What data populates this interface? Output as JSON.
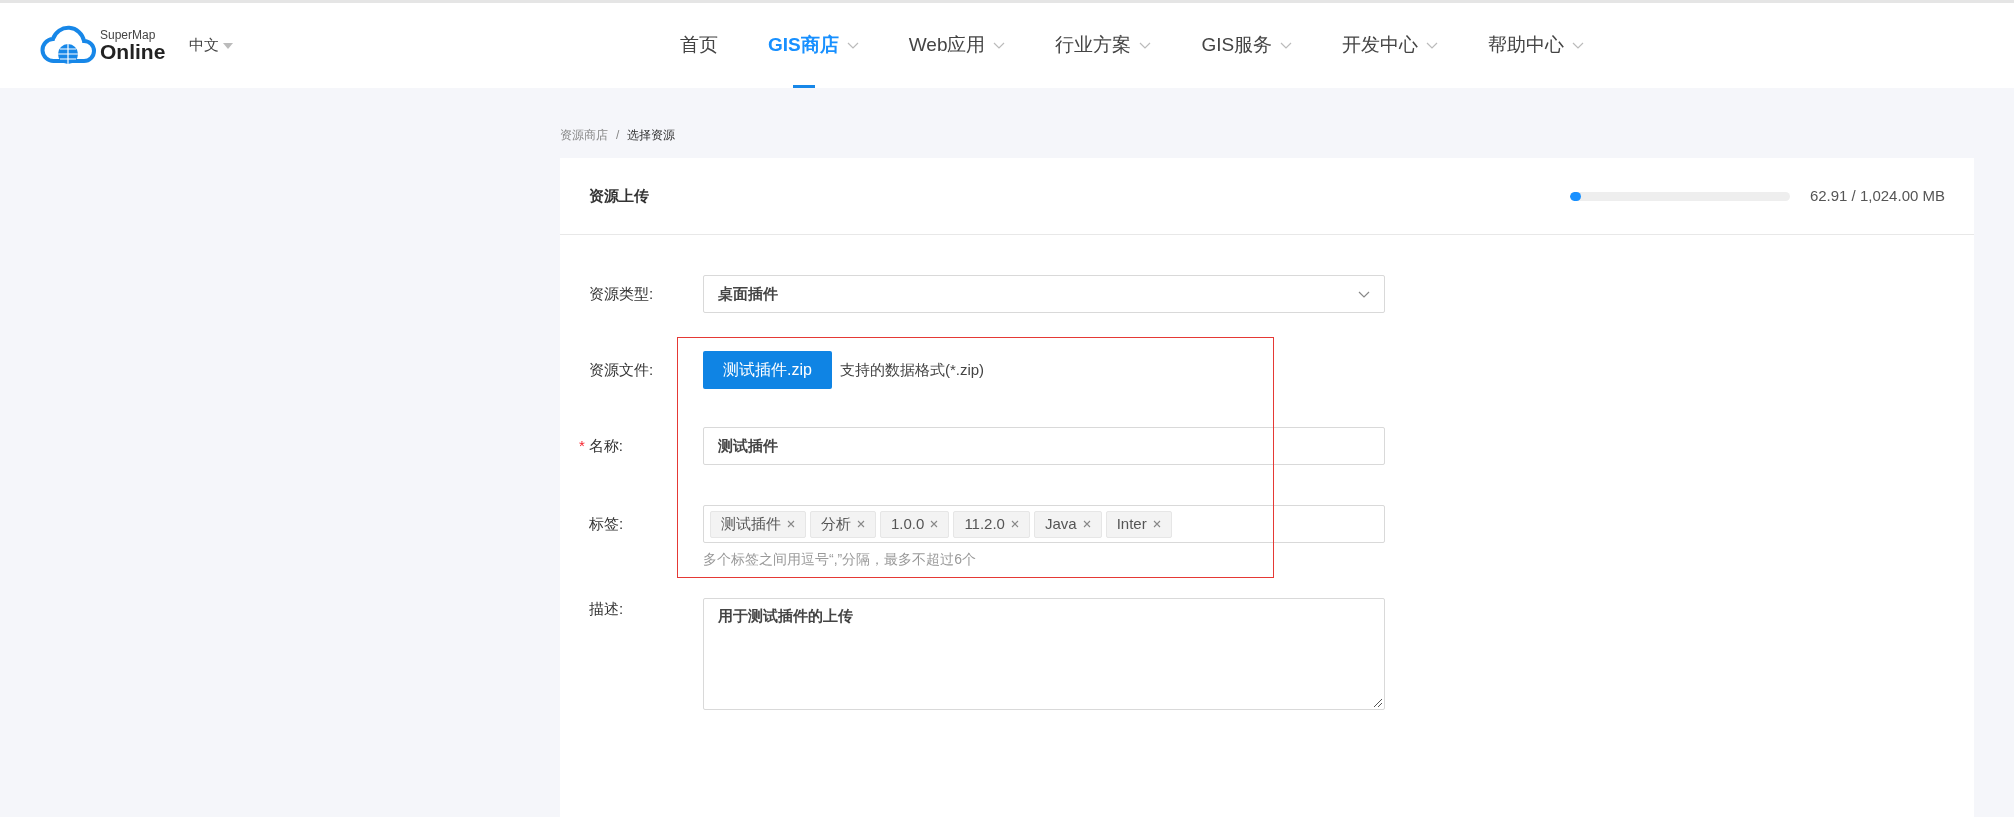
{
  "header": {
    "logo": {
      "small": "SuperMap",
      "large": "Online"
    },
    "language": "中文",
    "nav": [
      {
        "label": "首页",
        "selected": false,
        "dropdown": false
      },
      {
        "label": "GIS商店",
        "selected": true,
        "dropdown": true
      },
      {
        "label": "Web应用",
        "selected": false,
        "dropdown": true
      },
      {
        "label": "行业方案",
        "selected": false,
        "dropdown": true
      },
      {
        "label": "GIS服务",
        "selected": false,
        "dropdown": true
      },
      {
        "label": "开发中心",
        "selected": false,
        "dropdown": true
      },
      {
        "label": "帮助中心",
        "selected": false,
        "dropdown": true
      }
    ]
  },
  "breadcrumb": [
    "资源商店",
    "/",
    "选择资源"
  ],
  "card": {
    "title": "资源上传",
    "storage": {
      "level": 0.05,
      "reading": "62.91 / 1,024.00 MB"
    }
  },
  "form": {
    "type": {
      "label": "资源类型:",
      "value": "桌面插件"
    },
    "file": {
      "label": "资源文件:",
      "button": "测试插件.zip",
      "hint": "支持的数据格式(*.zip)"
    },
    "name": {
      "label": "名称:",
      "required_mark": "*",
      "value": "测试插件"
    },
    "tags": {
      "label": "标签:",
      "items": [
        "测试插件",
        "分析",
        "1.0.0",
        "11.2.0",
        "Java",
        "Inter"
      ],
      "hint": "多个标签之间用逗号“,”分隔，最多不超过6个"
    },
    "description": {
      "label": "描述:",
      "value": "用于测试插件的上传"
    }
  },
  "annotation": {
    "kind": "highlight"
  }
}
